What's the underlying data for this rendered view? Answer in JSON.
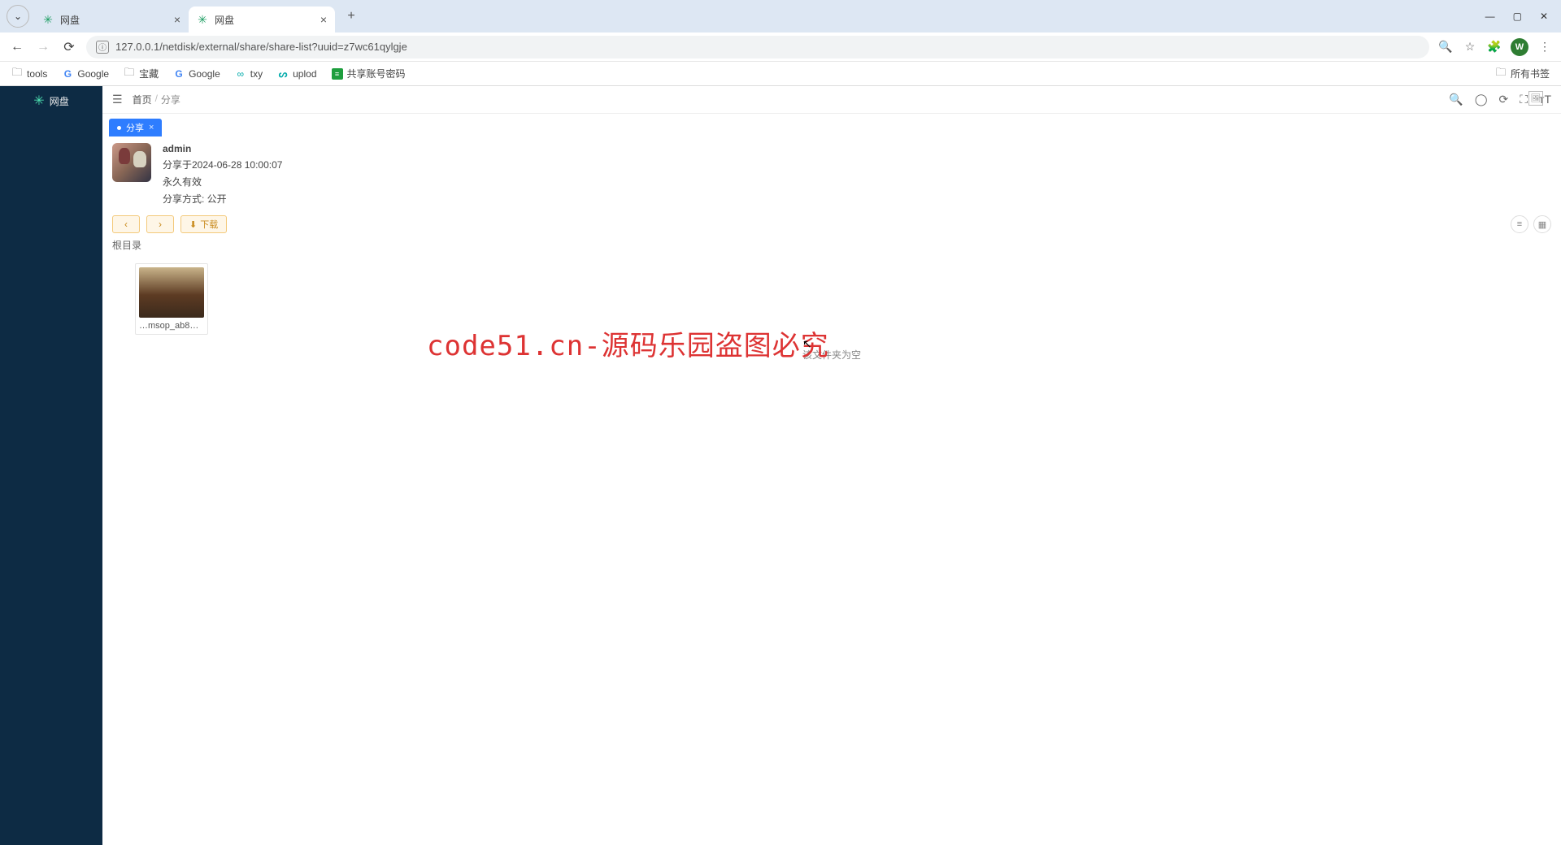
{
  "chrome": {
    "tabs": [
      {
        "title": "网盘",
        "active": false
      },
      {
        "title": "网盘",
        "active": true
      }
    ],
    "url": "127.0.0.1/netdisk/external/share/share-list?uuid=z7wc61qylgje",
    "avatar_letter": "W"
  },
  "bookmarks": [
    {
      "label": "tools",
      "kind": "fold"
    },
    {
      "label": "Google",
      "kind": "gg"
    },
    {
      "label": "宝藏",
      "kind": "fold"
    },
    {
      "label": "Google",
      "kind": "gg"
    },
    {
      "label": "txy",
      "kind": "txy"
    },
    {
      "label": "uplod",
      "kind": "up"
    },
    {
      "label": "共享账号密码",
      "kind": "sh"
    }
  ],
  "bookmark_all": "所有书签",
  "logo": "网盘",
  "breadcrumb": {
    "home": "首页",
    "current": "分享"
  },
  "page_tab": "分享",
  "share": {
    "user": "admin",
    "time_label": "分享于2024-06-28 10:00:07",
    "validity": "永久有效",
    "method": "分享方式: 公开"
  },
  "controls": {
    "download": "下载"
  },
  "path": "根目录",
  "files": [
    {
      "name": "…msop_ab8…"
    }
  ],
  "empty": "该文件夹为空",
  "watermark_text": "code51.cn",
  "watermark_big": "code51.cn-源码乐园盗图必究"
}
